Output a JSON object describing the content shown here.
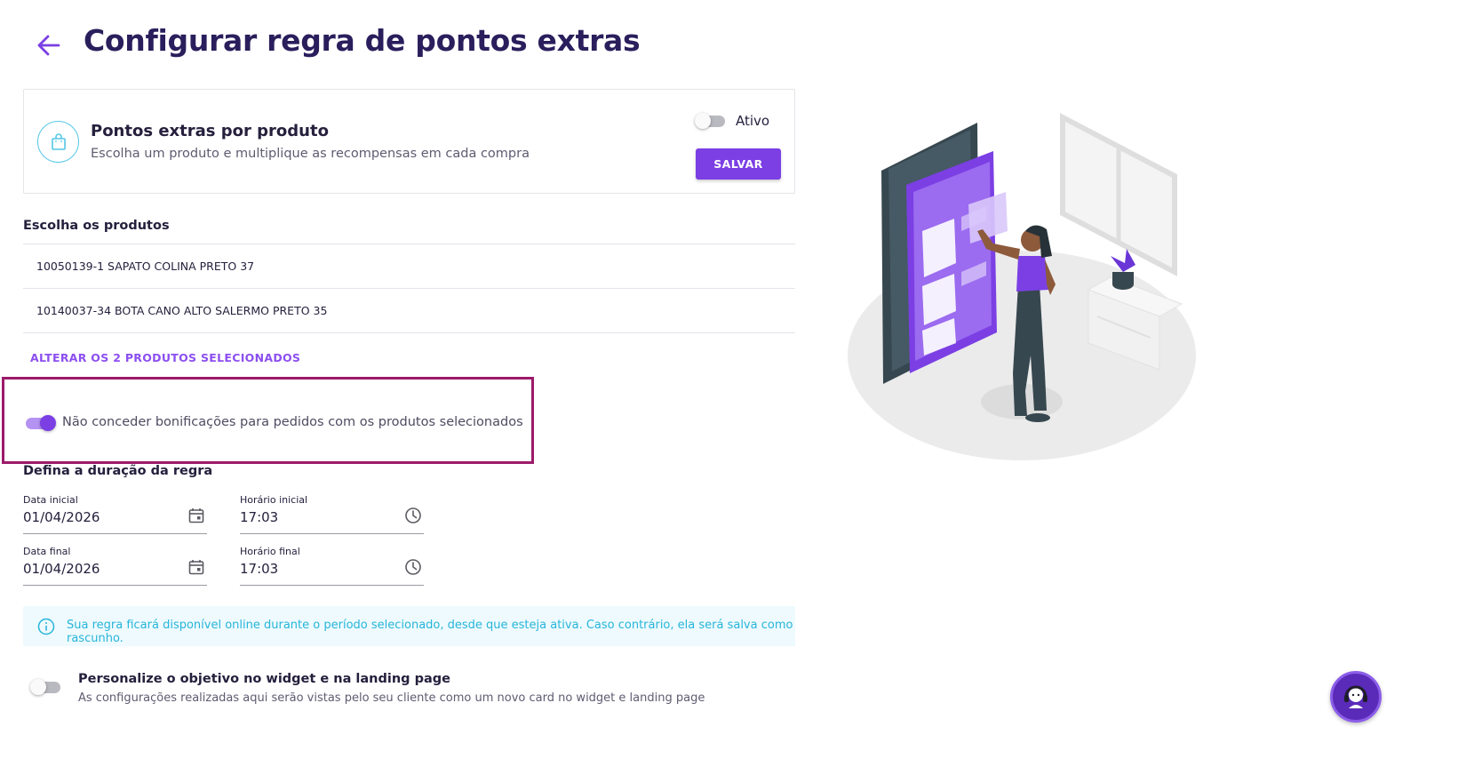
{
  "header": {
    "title": "Configurar regra de pontos extras",
    "back_icon": "arrow-left-icon"
  },
  "rule_card": {
    "title": "Pontos extras por produto",
    "subtitle": "Escolha um produto e multiplique as recompensas em cada compra",
    "icon": "shopping-bag-icon",
    "status_label": "Ativo",
    "status_on": false,
    "save_label": "SALVAR"
  },
  "products": {
    "section_title": "Escolha os produtos",
    "items": [
      "10050139-1 SAPATO COLINA PRETO 37",
      "10140037-34 BOTA CANO ALTO SALERMO PRETO 35"
    ],
    "change_label": "ALTERAR OS 2 PRODUTOS SELECIONADOS"
  },
  "exclusion": {
    "label": "Não conceder bonificações para pedidos com os produtos selecionados",
    "enabled": true
  },
  "duration": {
    "section_title": "Defina a duração da regra",
    "start_date_label": "Data inicial",
    "start_date": "01/04/2026",
    "start_time_label": "Horário inicial",
    "start_time": "17:03",
    "end_date_label": "Data final",
    "end_date": "01/04/2026",
    "end_time_label": "Horário final",
    "end_time": "17:03"
  },
  "info": {
    "text": "Sua regra ficará disponível online durante o período selecionado, desde que esteja ativa. Caso contrário, ela será salva como rascunho."
  },
  "widget": {
    "title": "Personalize o objetivo no widget e na landing page",
    "subtitle": "As configurações realizadas aqui serão vistas pelo seu cliente como um novo card no widget e landing page",
    "enabled": false
  },
  "colors": {
    "accent": "#7b3fe4",
    "title": "#2a1e5c",
    "info": "#27b5da",
    "highlight": "#9d1a6a"
  },
  "support": {
    "icon": "headset-support-icon"
  }
}
